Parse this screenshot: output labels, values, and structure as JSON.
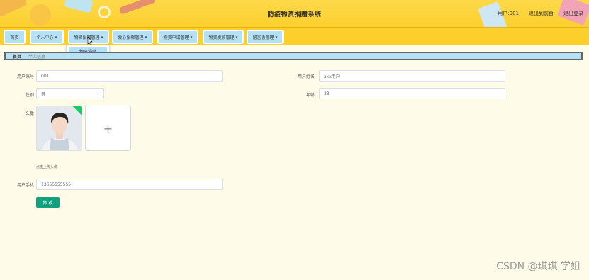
{
  "header": {
    "title": "防疫物资捐赠系统",
    "user_label": "用户:001",
    "back_link": "退出到前台",
    "logout_link": "退出登录"
  },
  "nav": {
    "items": [
      {
        "label": "首页",
        "has_caret": false
      },
      {
        "label": "个人中心",
        "has_caret": true
      },
      {
        "label": "物资捐赠管理",
        "has_caret": true
      },
      {
        "label": "爱心捐献管理",
        "has_caret": true
      },
      {
        "label": "物资申请管理",
        "has_caret": true
      },
      {
        "label": "物资发放管理",
        "has_caret": true
      },
      {
        "label": "留言板管理",
        "has_caret": true
      }
    ],
    "dropdown_item": "物资捐赠"
  },
  "breadcrumb": {
    "home": "首页",
    "current": "个人信息"
  },
  "form": {
    "account_label": "用户账号",
    "account_value": "001",
    "name_label": "用户姓名",
    "name_value": "xxx用户",
    "gender_label": "性别",
    "gender_value": "男",
    "age_label": "年龄",
    "age_value": "33",
    "avatar_label": "头像",
    "upload_plus": "+",
    "upload_hint": "点击上传头像",
    "phone_label": "用户手机",
    "phone_value": "13655555555",
    "submit_label": "修 改"
  },
  "watermark": "CSDN @琪琪 学姐",
  "colors": {
    "header_bg": "#fccf2d",
    "nav_button": "#b4e1f6",
    "page_bg": "#fefbe9",
    "submit_button": "#13a07f",
    "avatar_badge": "#13ce66"
  }
}
